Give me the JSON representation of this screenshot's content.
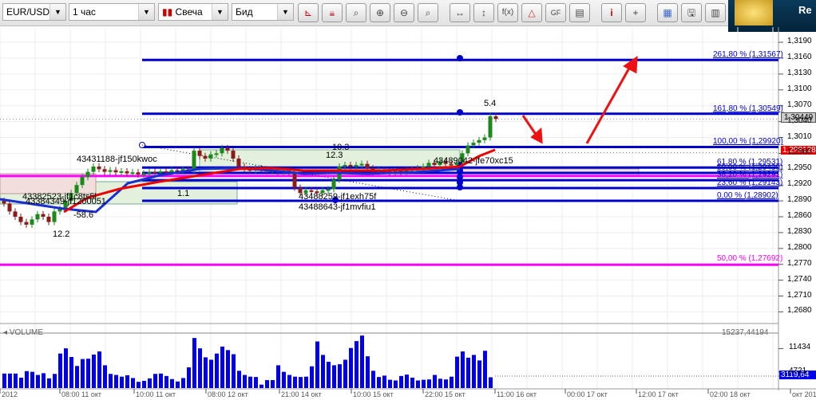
{
  "toolbar": {
    "symbol": "EUR/USD",
    "timeframe": "1 час",
    "chart_type": "Свеча",
    "price_type": "Бид",
    "buttons": [
      "axis-icon",
      "lock-icon",
      "zoom-fit-icon",
      "zoom-in-icon",
      "zoom-out-icon",
      "zoom-area-icon",
      "scroll-horizontal-icon",
      "scale-vertical-icon",
      "f(x)",
      "shapes-icon",
      "GF",
      "notes-icon",
      "i",
      "crosshair-icon",
      "colors-icon",
      "save-icon",
      "layout-icon"
    ],
    "fx_label": "f(x)",
    "gf_label": "GF",
    "info_label": "i"
  },
  "ad": {
    "text": "Re"
  },
  "price_axis": {
    "ticks": [
      "1,3190",
      "1,3160",
      "1,3130",
      "1,3100",
      "1,3070",
      "1,3040",
      "1,3010",
      "1,2980",
      "1,2950",
      "1,2920",
      "1,2890",
      "1,2860",
      "1,2830",
      "1,2800",
      "1,2770",
      "1,2740",
      "1,2710",
      "1,2680"
    ],
    "tick_values": [
      1.319,
      1.316,
      1.313,
      1.31,
      1.307,
      1.304,
      1.301,
      1.298,
      1.295,
      1.292,
      1.289,
      1.286,
      1.283,
      1.28,
      1.277,
      1.274,
      1.271,
      1.268
    ],
    "current_price": "1,30449",
    "current_value": 1.30449,
    "bid_price": "1,298128",
    "bid_value": 1.298128
  },
  "fib_levels": [
    {
      "label": "261,80 % (1,31567)",
      "value": 1.31567
    },
    {
      "label": "161,80 % (1,30549)",
      "value": 1.30549
    },
    {
      "label": "100,00 % (1,29920)",
      "value": 1.2992
    },
    {
      "label": "61,80 % (1,29531)",
      "value": 1.29531
    },
    {
      "label": "50,00 % (1,29430)",
      "value": 1.2943
    },
    {
      "label": "38,20 % (1,29291)",
      "value": 1.29291
    },
    {
      "label": "23,60 % (1,29143)",
      "value": 1.29143
    },
    {
      "label": "0,00 % (1,28902)",
      "value": 1.28902
    }
  ],
  "magenta_levels": [
    {
      "label": "",
      "value": 1.2937
    },
    {
      "label": "50,00 % (1,27692)",
      "value": 1.27692
    }
  ],
  "annotations": {
    "a1": "43431188-jf150kwoc",
    "a2": "43382523-jf1c8ts5l",
    "a3": "43384349-jf1200051",
    "a4": "12.2",
    "a5": "-58.6",
    "a6": "1.1",
    "a7": "12.3",
    "a8": "10.3",
    "a9": "43488259-jf1exh75f",
    "a10": "43488643-jf1mvfiu1",
    "a11": "43489042-jfe70xc15",
    "a12": "5.4"
  },
  "colors": {
    "bull": "#1a8a1a",
    "bear": "#8b1a1a",
    "fib": "#0000cc",
    "magenta": "#ff00ff",
    "arrow": "#ee1111",
    "volume": "#0000ee"
  },
  "closes": [
    1.2885,
    1.287,
    1.286,
    1.285,
    1.2845,
    1.2855,
    1.2865,
    1.286,
    1.285,
    1.287,
    1.2875,
    1.289,
    1.2905,
    1.292,
    1.2935,
    1.2945,
    1.2955,
    1.295,
    1.2945,
    1.2948,
    1.2944,
    1.2946,
    1.2942,
    1.2944,
    1.294,
    1.2942,
    1.2945,
    1.2943,
    1.2946,
    1.2944,
    1.2948,
    1.2946,
    1.295,
    1.2948,
    1.2985,
    1.2975,
    1.297,
    1.2978,
    1.298,
    1.299,
    1.2985,
    1.297,
    1.2955,
    1.295,
    1.2948,
    1.2952,
    1.295,
    1.2946,
    1.2948,
    1.2945,
    1.2947,
    1.2944,
    1.2915,
    1.2905,
    1.291,
    1.2908,
    1.2905,
    1.291,
    1.2912,
    1.293,
    1.2955,
    1.2958,
    1.2955,
    1.2958,
    1.296,
    1.2952,
    1.2945,
    1.2948,
    1.2946,
    1.2944,
    1.2947,
    1.2945,
    1.2948,
    1.295,
    1.2952,
    1.2955,
    1.2962,
    1.2958,
    1.2965,
    1.296,
    1.2958,
    1.2962,
    1.298,
    1.2995,
    1.3,
    1.3005,
    1.301,
    1.305,
    1.3045
  ],
  "volume": {
    "label": "VOLUME",
    "max_label": "15237,44194",
    "ticks": [
      "11434",
      "4721"
    ],
    "tick_values": [
      11434,
      4721
    ],
    "current": "3119,64",
    "max": 15237,
    "values": [
      4200,
      4200,
      4200,
      3000,
      4900,
      4700,
      3800,
      4300,
      2800,
      4100,
      10000,
      11500,
      9000,
      6400,
      8400,
      8500,
      9700,
      10600,
      6600,
      4100,
      3800,
      3300,
      3700,
      2900,
      1800,
      2100,
      2800,
      4100,
      4200,
      3500,
      2600,
      1900,
      2900,
      6000,
      14500,
      11500,
      8900,
      8200,
      10000,
      12000,
      11000,
      9800,
      5000,
      3800,
      3300,
      3200,
      1000,
      2300,
      2300,
      6600,
      4700,
      3800,
      3300,
      3200,
      3300,
      6300,
      13500,
      9600,
      7600,
      6600,
      6900,
      8200,
      11600,
      13600,
      15200,
      9200,
      5000,
      3200,
      3600,
      2400,
      2200,
      3500,
      3900,
      3000,
      2200,
      2400,
      2500,
      3800,
      2700,
      2500,
      3300,
      9100,
      10600,
      8800,
      9600,
      8000,
      10800,
      3119
    ]
  },
  "time_axis": [
    "2012",
    "08:00 11 окт",
    "10:00 11 окт",
    "08:00 12 окт",
    "21:00 14 окт",
    "10:00 15 окт",
    "22:00 15 окт",
    "11:00 16 окт",
    "00:00 17 окт",
    "12:00 17 окт",
    "02:00 18 окт",
    "окт 201"
  ]
}
